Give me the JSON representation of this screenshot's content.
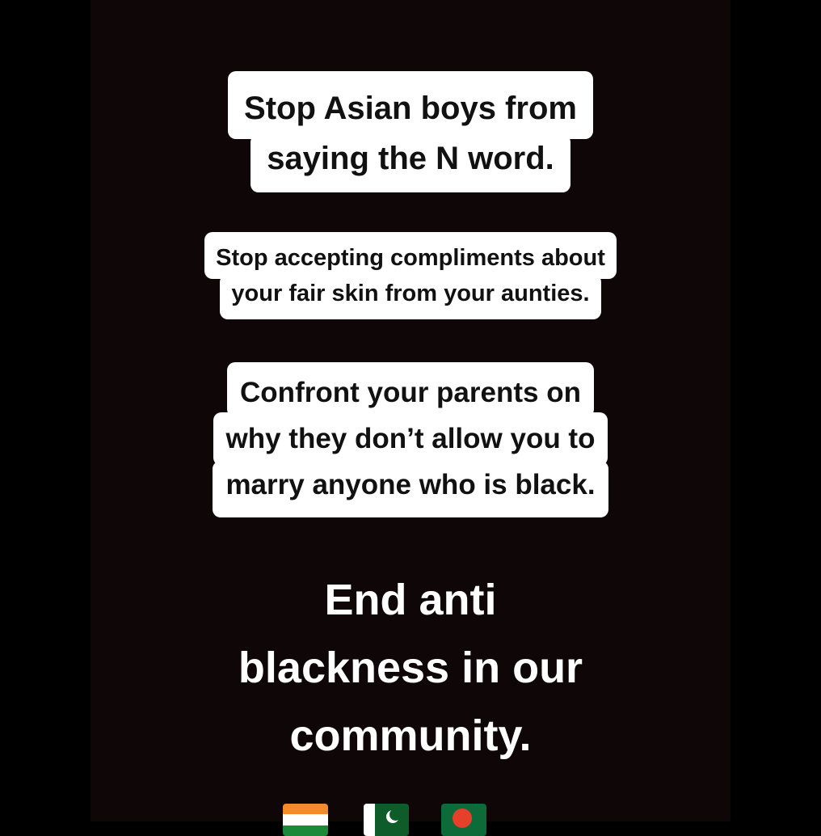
{
  "story": {
    "background_color": "#0f0707",
    "labels": [
      {
        "lines": [
          "Stop Asian boys from",
          "saying the N word."
        ]
      },
      {
        "lines": [
          "Stop accepting compliments about",
          "your fair skin from your aunties."
        ]
      },
      {
        "lines": [
          "Confront your parents on",
          "why they don’t allow you to",
          "marry anyone who is black."
        ]
      }
    ],
    "headline": {
      "lines": [
        "End anti",
        "blackness in our",
        "community."
      ]
    },
    "flags": [
      "india-flag-icon",
      "pakistan-flag-icon",
      "bangladesh-flag-icon"
    ]
  }
}
